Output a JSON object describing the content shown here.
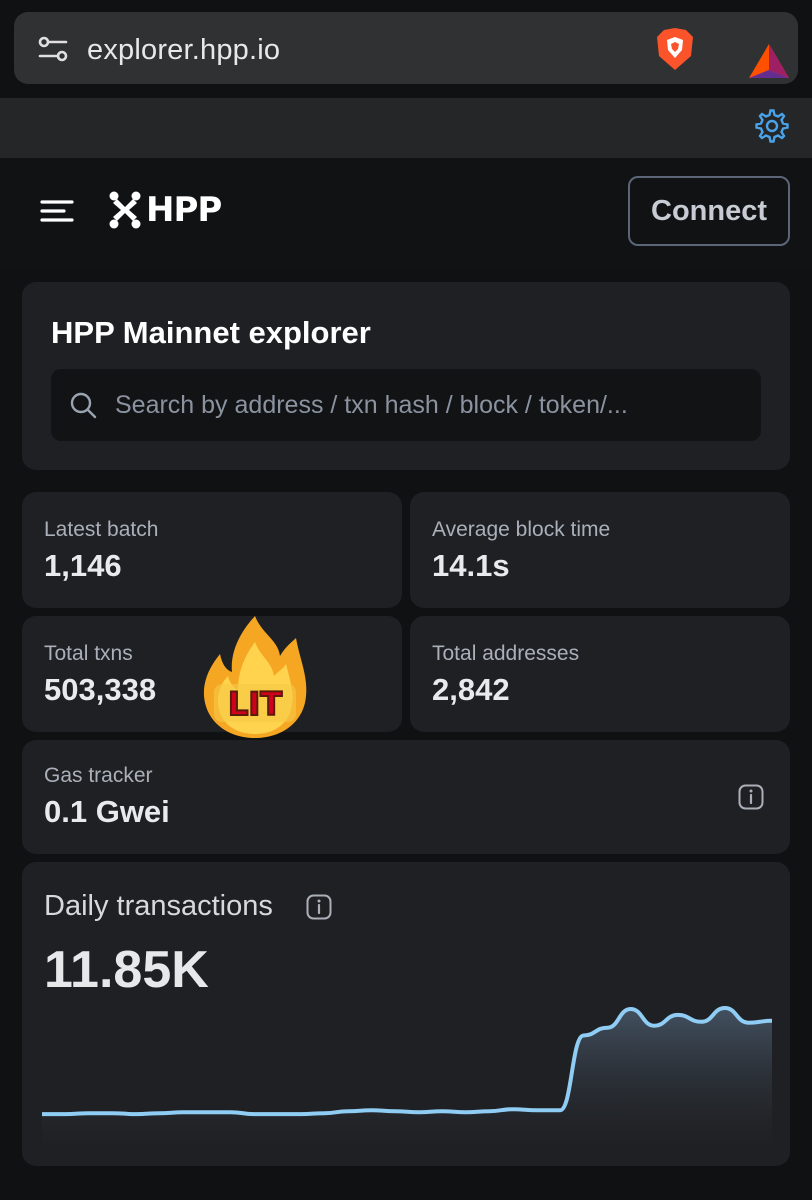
{
  "browser": {
    "url": "explorer.hpp.io"
  },
  "header": {
    "logo_text": "HPP",
    "connect_label": "Connect"
  },
  "hero": {
    "title": "HPP Mainnet explorer",
    "search_placeholder": "Search by address / txn hash / block / token/..."
  },
  "stats": {
    "latest_batch": {
      "label": "Latest batch",
      "value": "1,146"
    },
    "avg_block_time": {
      "label": "Average block time",
      "value": "14.1s"
    },
    "total_txns": {
      "label": "Total txns",
      "value": "503,338"
    },
    "total_addresses": {
      "label": "Total addresses",
      "value": "2,842"
    },
    "gas_tracker": {
      "label": "Gas tracker",
      "value": "0.1 Gwei"
    }
  },
  "sticker": {
    "text": "LIT"
  },
  "daily": {
    "title": "Daily transactions",
    "value": "11.85K"
  },
  "colors": {
    "accent": "#3f8fd6",
    "line": "#90cdf4",
    "card": "#1f2023",
    "background": "#111213"
  },
  "chart_data": {
    "type": "area",
    "title": "Daily transactions",
    "values": [
      0.8,
      0.8,
      0.9,
      0.9,
      0.8,
      0.9,
      1.0,
      1.0,
      1.0,
      0.8,
      0.8,
      0.8,
      0.9,
      1.1,
      1.2,
      1.1,
      1.0,
      1.1,
      1.0,
      1.1,
      1.3,
      1.2,
      1.2,
      8.8,
      9.6,
      11.5,
      9.8,
      10.9,
      10.2,
      11.6,
      10.1,
      10.3
    ]
  }
}
